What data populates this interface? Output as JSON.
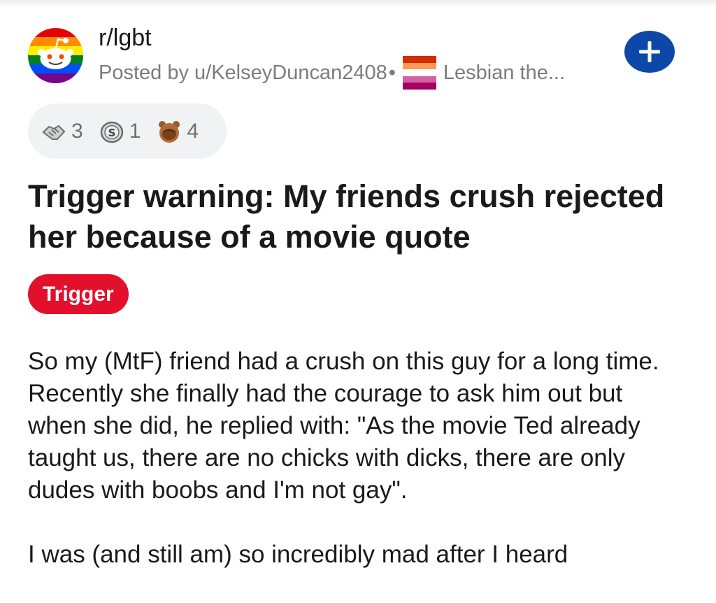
{
  "post": {
    "subreddit": "r/lgbt",
    "posted_by": "Posted by u/KelseyDuncan2408",
    "separator": "•",
    "user_flair": "Lesbian the...",
    "awards": [
      {
        "icon": "handshake-award-icon",
        "count": "3"
      },
      {
        "icon": "silver-coin-award-icon",
        "count": "1"
      },
      {
        "icon": "facepalm-bear-award-icon",
        "count": "4"
      }
    ],
    "title": "Trigger warning: My friends crush rejected her because of a movie quote",
    "flair": "Trigger",
    "body": [
      "So my (MtF) friend had a crush on this guy for a long time. Recently she finally had the courage to ask him out but when she did, he replied with: \"As the movie Ted already taught us, there are no chicks with dicks, there are only dudes with boobs and I'm not gay\".",
      "I was (and still am) so incredibly mad after I heard"
    ]
  },
  "colors": {
    "join_button": "#0d48a8",
    "flair_background": "#e3102b",
    "muted_text": "#7c7c7c",
    "awards_background": "#f1f2f4"
  }
}
